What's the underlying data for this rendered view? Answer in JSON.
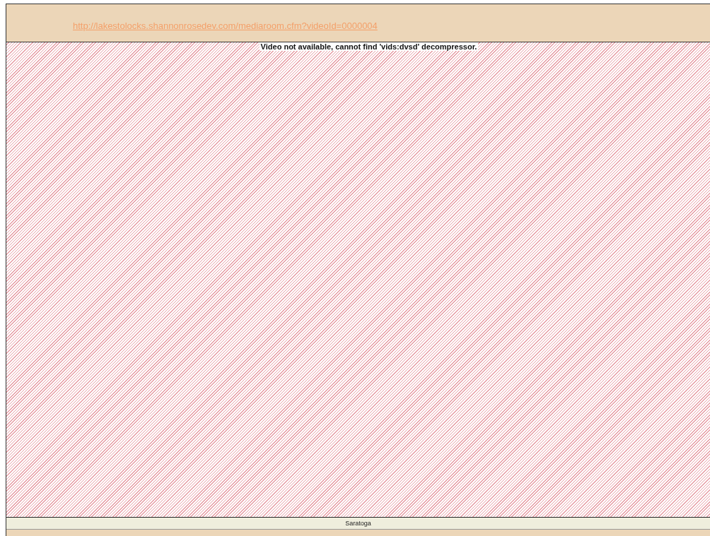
{
  "header": {
    "link": "http://lakestolocks.shannonrosedev.com/mediaroom.cfm?videoId=0000004"
  },
  "video": {
    "message": "Video not available, cannot find 'vids:dvsd' decompressor."
  },
  "caption": "Saratoga"
}
